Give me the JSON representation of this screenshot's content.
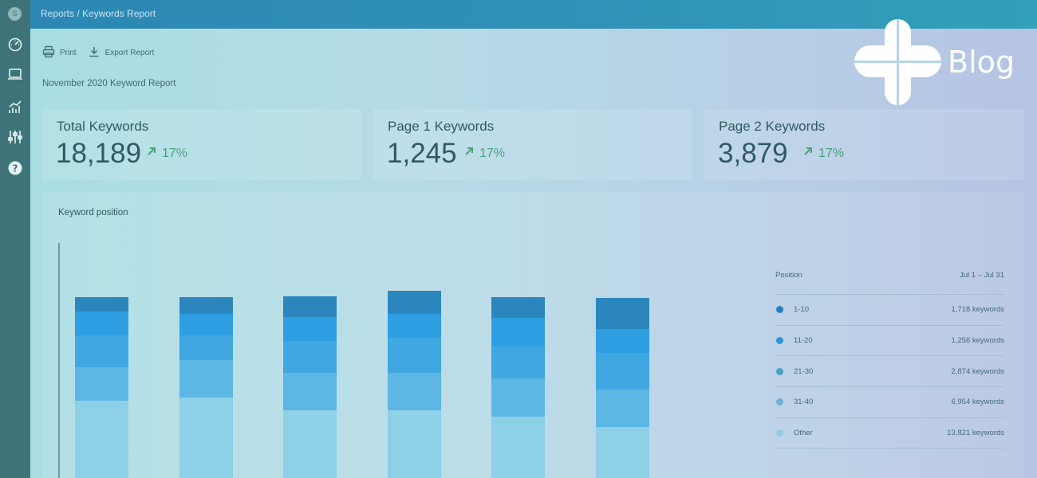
{
  "sidebar": {
    "logo_letter": "S",
    "icons": [
      "dashboard-icon",
      "laptop-icon",
      "analytics-icon",
      "sliders-icon",
      "help-icon"
    ]
  },
  "topbar": {
    "breadcrumb": "Reports / Keywords Report"
  },
  "toolbar": {
    "print_label": "Print",
    "export_label": "Export Report"
  },
  "report_title": "November 2020 Keyword Report",
  "brand": {
    "word": "Blog"
  },
  "stats": [
    {
      "label": "Total Keywords",
      "value": "18,189",
      "change": "17%"
    },
    {
      "label": "Page 1 Keywords",
      "value": "1,245",
      "change": "17%"
    },
    {
      "label": "Page 2 Keywords",
      "value": "3,879",
      "change": "17%"
    }
  ],
  "chart_panel": {
    "title": "Keyword position"
  },
  "legend": {
    "header_left": "Position",
    "header_right": "Jul 1 – Jul 31",
    "rows": [
      {
        "label": "1-10",
        "count": "1,718 keywords",
        "color": "#2b7fb8"
      },
      {
        "label": "11-20",
        "count": "1,256 keywords",
        "color": "#2f95dd"
      },
      {
        "label": "21-30",
        "count": "2,874 keywords",
        "color": "#4aa0c4"
      },
      {
        "label": "31-40",
        "count": "6,954 keywords",
        "color": "#6fb1d6"
      },
      {
        "label": "Other",
        "count": "13,821 keywords",
        "color": "#8fcde0"
      }
    ]
  },
  "colors": {
    "sidebar": "#3e7479",
    "topbar": "#2c87b4",
    "trend_up": "#4aa17c"
  },
  "chart_data": {
    "type": "bar",
    "stacked": true,
    "categories": [
      "",
      "",
      "",
      "",
      "",
      ""
    ],
    "series": [
      {
        "name": "1-10",
        "values": [
          18,
          21,
          26,
          29,
          26,
          39
        ]
      },
      {
        "name": "11-20",
        "values": [
          30,
          27,
          30,
          30,
          36,
          30
        ]
      },
      {
        "name": "21-30",
        "values": [
          40,
          31,
          40,
          44,
          40,
          46
        ]
      },
      {
        "name": "31-40",
        "values": [
          42,
          47,
          47,
          47,
          48,
          47
        ]
      },
      {
        "name": "Other",
        "values": [
          108,
          112,
          96,
          96,
          88,
          75
        ]
      }
    ],
    "series_colors": [
      "#2b86bd",
      "#2e9ee3",
      "#3fa8e2",
      "#5db7e4",
      "#8ed0e6"
    ],
    "grid": false
  }
}
